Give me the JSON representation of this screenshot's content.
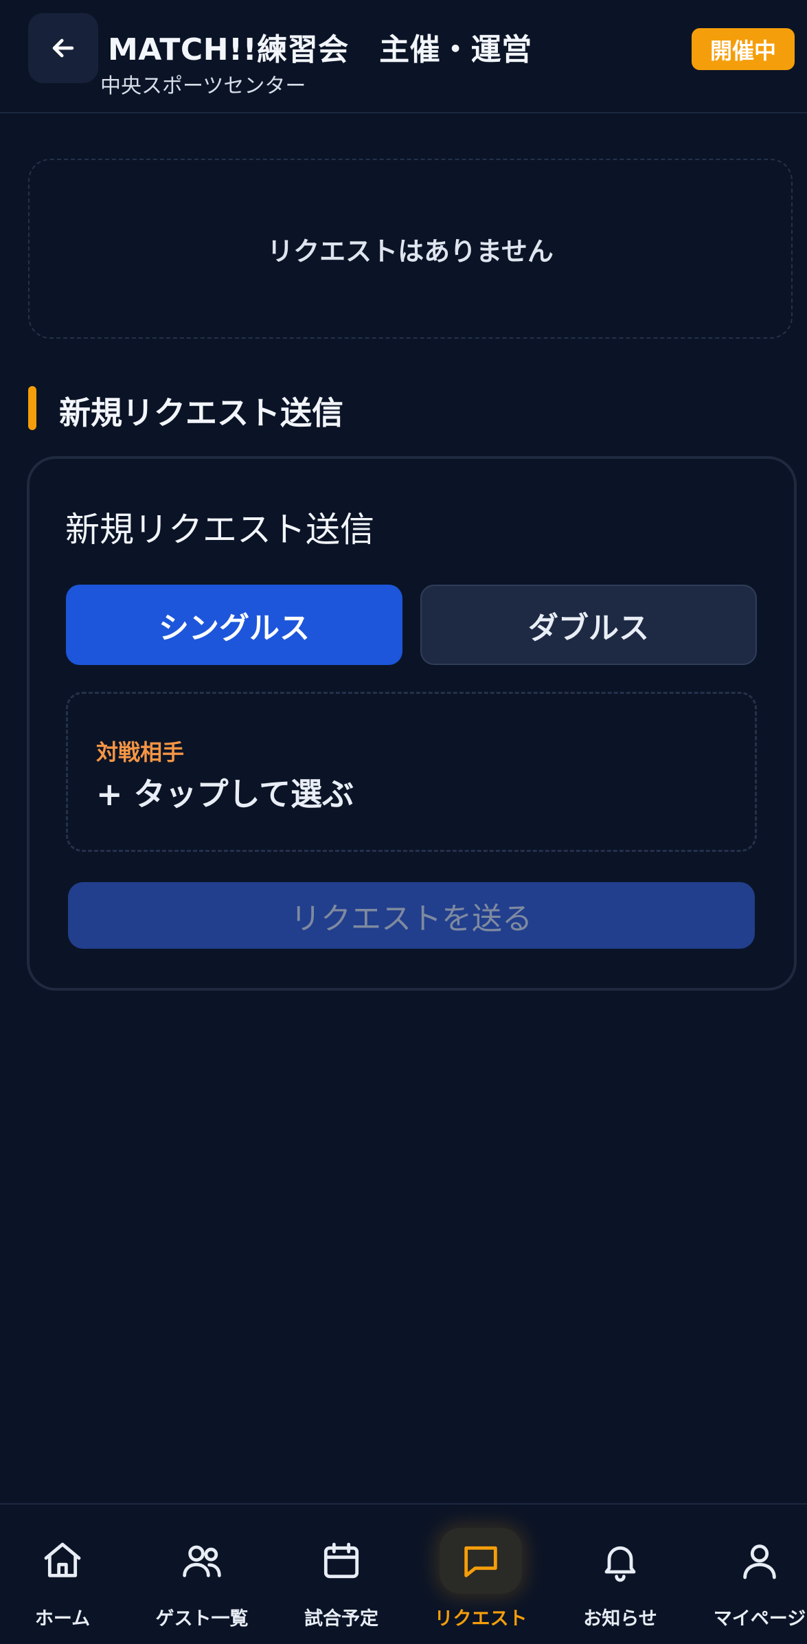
{
  "header": {
    "title": "MATCH!!練習会　主催・運営",
    "subtitle": "中央スポーツセンター",
    "status": "開催中"
  },
  "requests": {
    "empty_text": "リクエストはありません"
  },
  "new_request": {
    "section_title": "新規リクエスト送信",
    "card_title": "新規リクエスト送信",
    "singles_label": "シングルス",
    "doubles_label": "ダブルス",
    "opponent_label": "対戦相手",
    "opponent_placeholder": "+ タップして選ぶ",
    "send_label": "リクエストを送る"
  },
  "nav": {
    "items": [
      {
        "label": "ホーム",
        "icon": "home-icon"
      },
      {
        "label": "ゲスト一覧",
        "icon": "users-icon"
      },
      {
        "label": "試合予定",
        "icon": "calendar-icon"
      },
      {
        "label": "リクエスト",
        "icon": "chat-icon",
        "active": true
      },
      {
        "label": "お知らせ",
        "icon": "bell-icon"
      },
      {
        "label": "マイページ",
        "icon": "user-icon"
      }
    ]
  },
  "colors": {
    "background": "#0b1426",
    "accent": "#f59e0b",
    "primary": "#1d56db"
  }
}
